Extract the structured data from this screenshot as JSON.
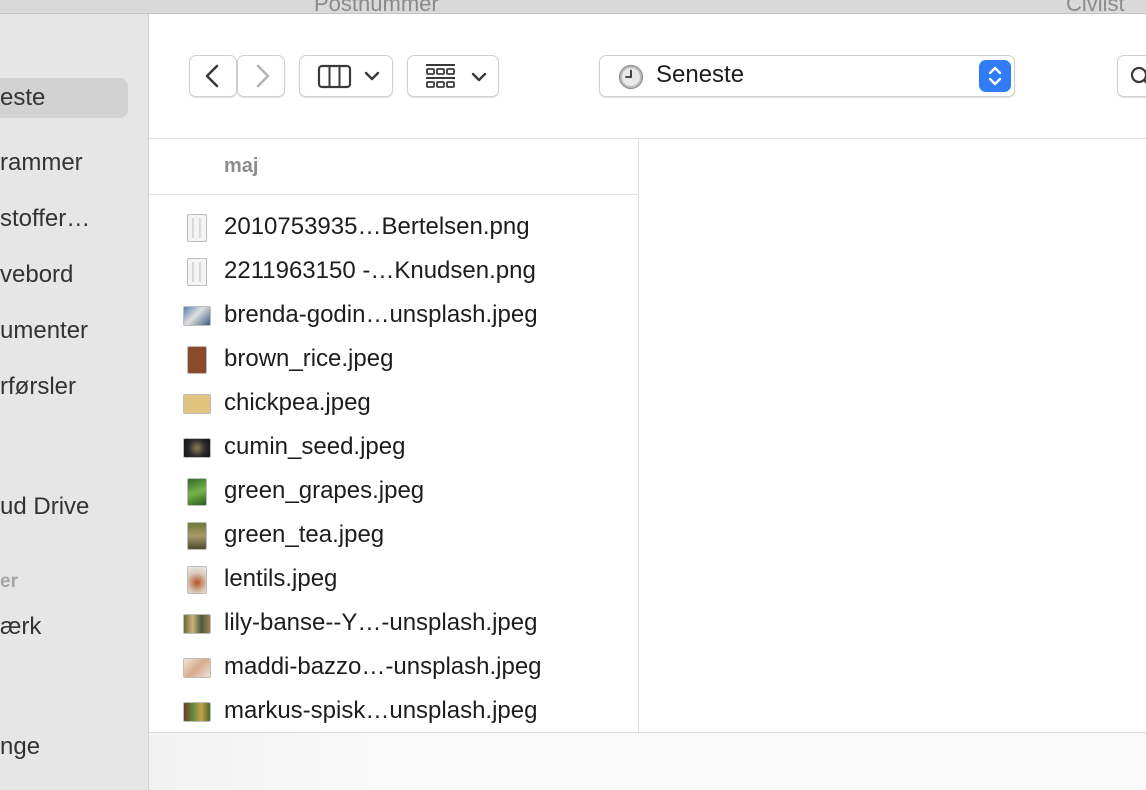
{
  "background_window": {
    "title_left": "Postnummer",
    "title_right": "Civilst"
  },
  "sidebar": {
    "items": [
      {
        "label": "este",
        "selected": true
      },
      {
        "label": "rammer",
        "selected": false
      },
      {
        "label": "stoffer…",
        "selected": false
      },
      {
        "label": "vebord",
        "selected": false
      },
      {
        "label": "umenter",
        "selected": false
      },
      {
        "label": "rførsler",
        "selected": false
      },
      {
        "label": "ud Drive",
        "selected": false
      },
      {
        "label": "ærk",
        "selected": false
      },
      {
        "label": "nge",
        "selected": false
      }
    ],
    "section_header": "er"
  },
  "toolbar": {
    "back_icon": "chevron-left-icon",
    "forward_icon": "chevron-right-icon",
    "view_icon": "column-view-icon",
    "group_icon": "grid-group-icon",
    "location_label": "Seneste",
    "location_icon": "clock-icon",
    "search_icon": "search-icon",
    "accent_color": "#2f7cf6"
  },
  "content": {
    "group_header": "maj",
    "files": [
      {
        "name": "2010753935…Bertelsen.png",
        "thumb": "document"
      },
      {
        "name": "2211963150 -…Knudsen.png",
        "thumb": "document"
      },
      {
        "name": "brenda-godin…unsplash.jpeg",
        "thumb": "photo-blue"
      },
      {
        "name": "brown_rice.jpeg",
        "thumb": "photo-brown"
      },
      {
        "name": "chickpea.jpeg",
        "thumb": "photo-tan"
      },
      {
        "name": "cumin_seed.jpeg",
        "thumb": "photo-dark"
      },
      {
        "name": "green_grapes.jpeg",
        "thumb": "photo-green"
      },
      {
        "name": "green_tea.jpeg",
        "thumb": "photo-olive"
      },
      {
        "name": "lentils.jpeg",
        "thumb": "photo-bowl"
      },
      {
        "name": "lily-banse--Y…-unsplash.jpeg",
        "thumb": "photo-mixed"
      },
      {
        "name": "maddi-bazzo…-unsplash.jpeg",
        "thumb": "photo-light"
      },
      {
        "name": "markus-spisk…unsplash.jpeg",
        "thumb": "photo-veg"
      }
    ]
  }
}
